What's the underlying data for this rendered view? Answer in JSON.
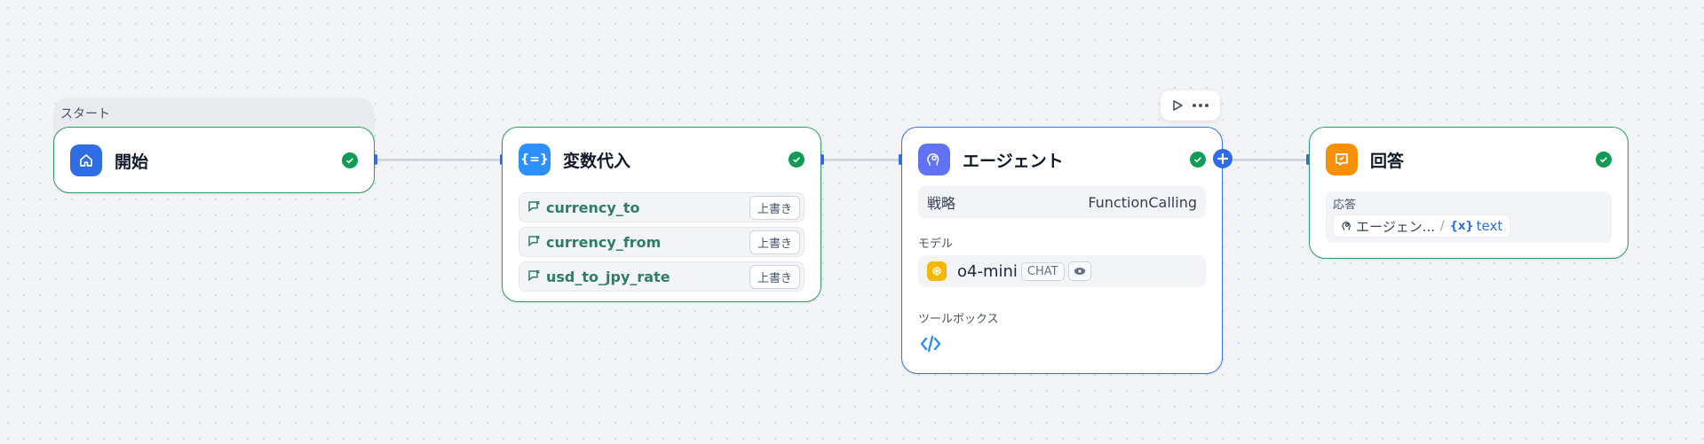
{
  "start_group": {
    "label": "スタート"
  },
  "nodes": {
    "start": {
      "title": "開始"
    },
    "assign": {
      "title": "変数代入",
      "variables": [
        {
          "name": "currency_to",
          "mode": "上書き"
        },
        {
          "name": "currency_from",
          "mode": "上書き"
        },
        {
          "name": "usd_to_jpy_rate",
          "mode": "上書き"
        }
      ]
    },
    "agent": {
      "title": "エージェント",
      "strategy_label": "戦略",
      "strategy_value": "FunctionCalling",
      "model_label": "モデル",
      "model_name": "o4-mini",
      "model_badge": "CHAT",
      "toolbox_label": "ツールボックス"
    },
    "answer": {
      "title": "回答",
      "response_label": "応答",
      "ref_source": "エージェン...",
      "ref_separator": "/",
      "ref_variable": "text"
    }
  },
  "colors": {
    "start_icon": "#2e6de6",
    "assign_icon": "#2e90fa",
    "agent_icon": "#6172f3",
    "answer_icon": "#f79009",
    "success": "#119c56",
    "node_border": "#2e9b62",
    "selected_border": "#3f6fe0"
  }
}
